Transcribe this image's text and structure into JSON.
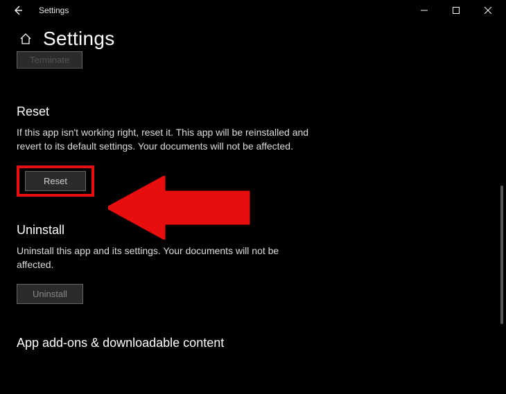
{
  "titlebar": {
    "title": "Settings"
  },
  "header": {
    "title": "Settings"
  },
  "terminate_button": {
    "label": "Terminate"
  },
  "reset": {
    "heading": "Reset",
    "description": "If this app isn't working right, reset it. This app will be reinstalled and revert to its default settings. Your documents will not be affected.",
    "button_label": "Reset"
  },
  "uninstall": {
    "heading": "Uninstall",
    "description": "Uninstall this app and its settings. Your documents will not be affected.",
    "button_label": "Uninstall"
  },
  "addons": {
    "heading": "App add-ons & downloadable content"
  }
}
